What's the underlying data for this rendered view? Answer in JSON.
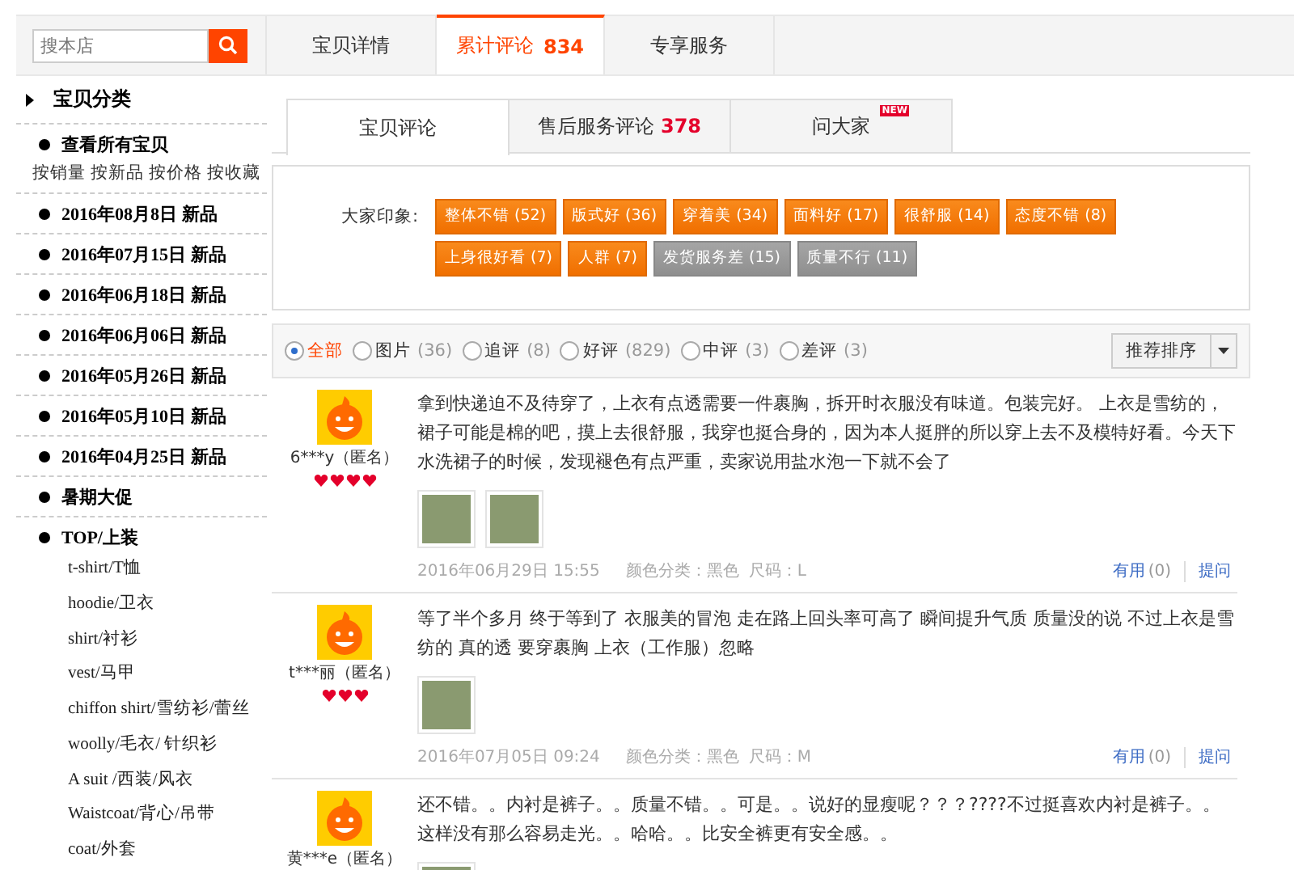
{
  "search": {
    "placeholder": "搜本店"
  },
  "top_tabs": [
    {
      "label": "宝贝详情",
      "selected": false
    },
    {
      "label": "累计评论",
      "count": "834",
      "selected": true
    },
    {
      "label": "专享服务",
      "selected": false
    }
  ],
  "sidebar": {
    "title": "宝贝分类",
    "items": [
      {
        "kind": "group",
        "label": "查看所有宝贝",
        "links": [
          "按销量",
          "按新品",
          "按价格",
          "按收藏"
        ]
      },
      {
        "kind": "group",
        "label": "2016年08月8日 新品"
      },
      {
        "kind": "group",
        "label": "2016年07月15日 新品"
      },
      {
        "kind": "group",
        "label": "2016年06月18日 新品"
      },
      {
        "kind": "group",
        "label": "2016年06月06日 新品"
      },
      {
        "kind": "group",
        "label": "2016年05月26日 新品"
      },
      {
        "kind": "group",
        "label": "2016年05月10日 新品"
      },
      {
        "kind": "group",
        "label": "2016年04月25日 新品"
      },
      {
        "kind": "group",
        "label": "暑期大促"
      },
      {
        "kind": "group",
        "label": "TOP/上装",
        "children": [
          "t-shirt/T恤",
          "hoodie/卫衣",
          "shirt/衬衫",
          "vest/马甲",
          "chiffon shirt/雪纺衫/蕾丝",
          "woolly/毛衣/ 针织衫",
          "A suit /西装/风衣",
          "Waistcoat/背心/吊带",
          "coat/外套"
        ]
      }
    ]
  },
  "sub_tabs": [
    {
      "label": "宝贝评论",
      "selected": true
    },
    {
      "label": "售后服务评论",
      "count": "378",
      "selected": false
    },
    {
      "label": "问大家",
      "badge": "NEW",
      "selected": false
    }
  ],
  "impressions": {
    "label": "大家印象:",
    "tags": [
      {
        "text": "整体不错 (52)",
        "kind": "positive"
      },
      {
        "text": "版式好 (36)",
        "kind": "positive"
      },
      {
        "text": "穿着美 (34)",
        "kind": "positive"
      },
      {
        "text": "面料好 (17)",
        "kind": "positive"
      },
      {
        "text": "很舒服 (14)",
        "kind": "positive"
      },
      {
        "text": "态度不错 (8)",
        "kind": "positive"
      },
      {
        "text": "上身很好看 (7)",
        "kind": "positive"
      },
      {
        "text": "人群 (7)",
        "kind": "positive"
      },
      {
        "text": "发货服务差 (15)",
        "kind": "negative"
      },
      {
        "text": "质量不行 (11)",
        "kind": "negative"
      }
    ]
  },
  "filters": [
    {
      "label": "全部",
      "selected": true
    },
    {
      "label": "图片",
      "count": "(36)",
      "selected": false
    },
    {
      "label": "追评",
      "count": "(8)",
      "selected": false
    },
    {
      "label": "好评",
      "count": "(829)",
      "selected": false
    },
    {
      "label": "中评",
      "count": "(3)",
      "selected": false
    },
    {
      "label": "差评",
      "count": "(3)",
      "selected": false
    }
  ],
  "sort": {
    "label": "推荐排序"
  },
  "reviews": [
    {
      "user": "6***y（匿名）",
      "stars": 4,
      "text": "拿到快递迫不及待穿了，上衣有点透需要一件裹胸，拆开时衣服没有味道。包装完好。 上衣是雪纺的，裙子可能是棉的吧，摸上去很舒服，我穿也挺合身的，因为本人挺胖的所以穿上去不及模特好看。今天下水洗裙子的时候，发现褪色有点严重，卖家说用盐水泡一下就不会了",
      "photos": [
        {
          "kind": "photo"
        },
        {
          "kind": "photo"
        }
      ],
      "date": "2016年06月29日 15:55",
      "color_option": "颜色分类：黑色",
      "size_option": "尺码：L",
      "useful": "有用",
      "useful_count": "(0)",
      "ask": "提问"
    },
    {
      "user": "t***丽（匿名）",
      "stars": 3,
      "text": "等了半个多月 终于等到了 衣服美的冒泡 走在路上回头率可高了 瞬间提升气质 质量没的说 不过上衣是雪纺的 真的透 要穿裹胸 上衣（工作服）忽略",
      "photos": [
        {
          "kind": "photo"
        }
      ],
      "date": "2016年07月05日 09:24",
      "color_option": "颜色分类：黑色",
      "size_option": "尺码：M",
      "useful": "有用",
      "useful_count": "(0)",
      "ask": "提问"
    },
    {
      "user": "黄***e（匿名）",
      "text": "还不错。。内衬是裤子。。质量不错。。可是。。说好的显瘦呢？？？????不过挺喜欢内衬是裤子。。这样没有那么容易走光。。哈哈。。比安全裤更有安全感。。",
      "photos": [
        {
          "kind": "photo"
        }
      ]
    }
  ]
}
